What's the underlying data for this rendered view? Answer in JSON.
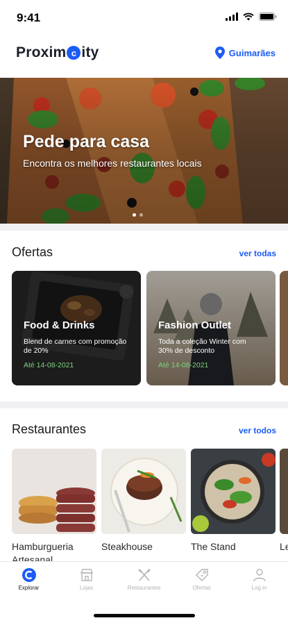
{
  "status_bar": {
    "time": "9:41"
  },
  "header": {
    "logo_prefix": "Proxim",
    "logo_mid": "c",
    "logo_suffix": "ity",
    "location": "Guimarães"
  },
  "hero": {
    "title": "Pede para casa",
    "subtitle": "Encontra os melhores restaurantes locais"
  },
  "offers": {
    "title": "Ofertas",
    "see_all": "ver todas",
    "items": [
      {
        "title": "Food & Drinks",
        "description": "Blend de carnes com promoção de 20%",
        "date": "Até 14-08-2021"
      },
      {
        "title": "Fashion Outlet",
        "description": "Toda a coleção Winter com 30% de desconto",
        "date": "Até 14-08-2021"
      }
    ]
  },
  "restaurants": {
    "title": "Restaurantes",
    "see_all": "ver todos",
    "items": [
      {
        "name": "Hamburgueria Artesanal"
      },
      {
        "name": "Steakhouse"
      },
      {
        "name": "The Stand"
      },
      {
        "name": "Le"
      }
    ]
  },
  "tabs": [
    {
      "label": "Explorar",
      "icon": "explore-icon"
    },
    {
      "label": "Lojas",
      "icon": "store-icon"
    },
    {
      "label": "Restaurantes",
      "icon": "fork-knife-icon"
    },
    {
      "label": "Ofertas",
      "icon": "tag-icon"
    },
    {
      "label": "Log in",
      "icon": "user-icon"
    }
  ],
  "colors": {
    "accent": "#1c5cf5",
    "offer_date": "#7ed37e"
  }
}
